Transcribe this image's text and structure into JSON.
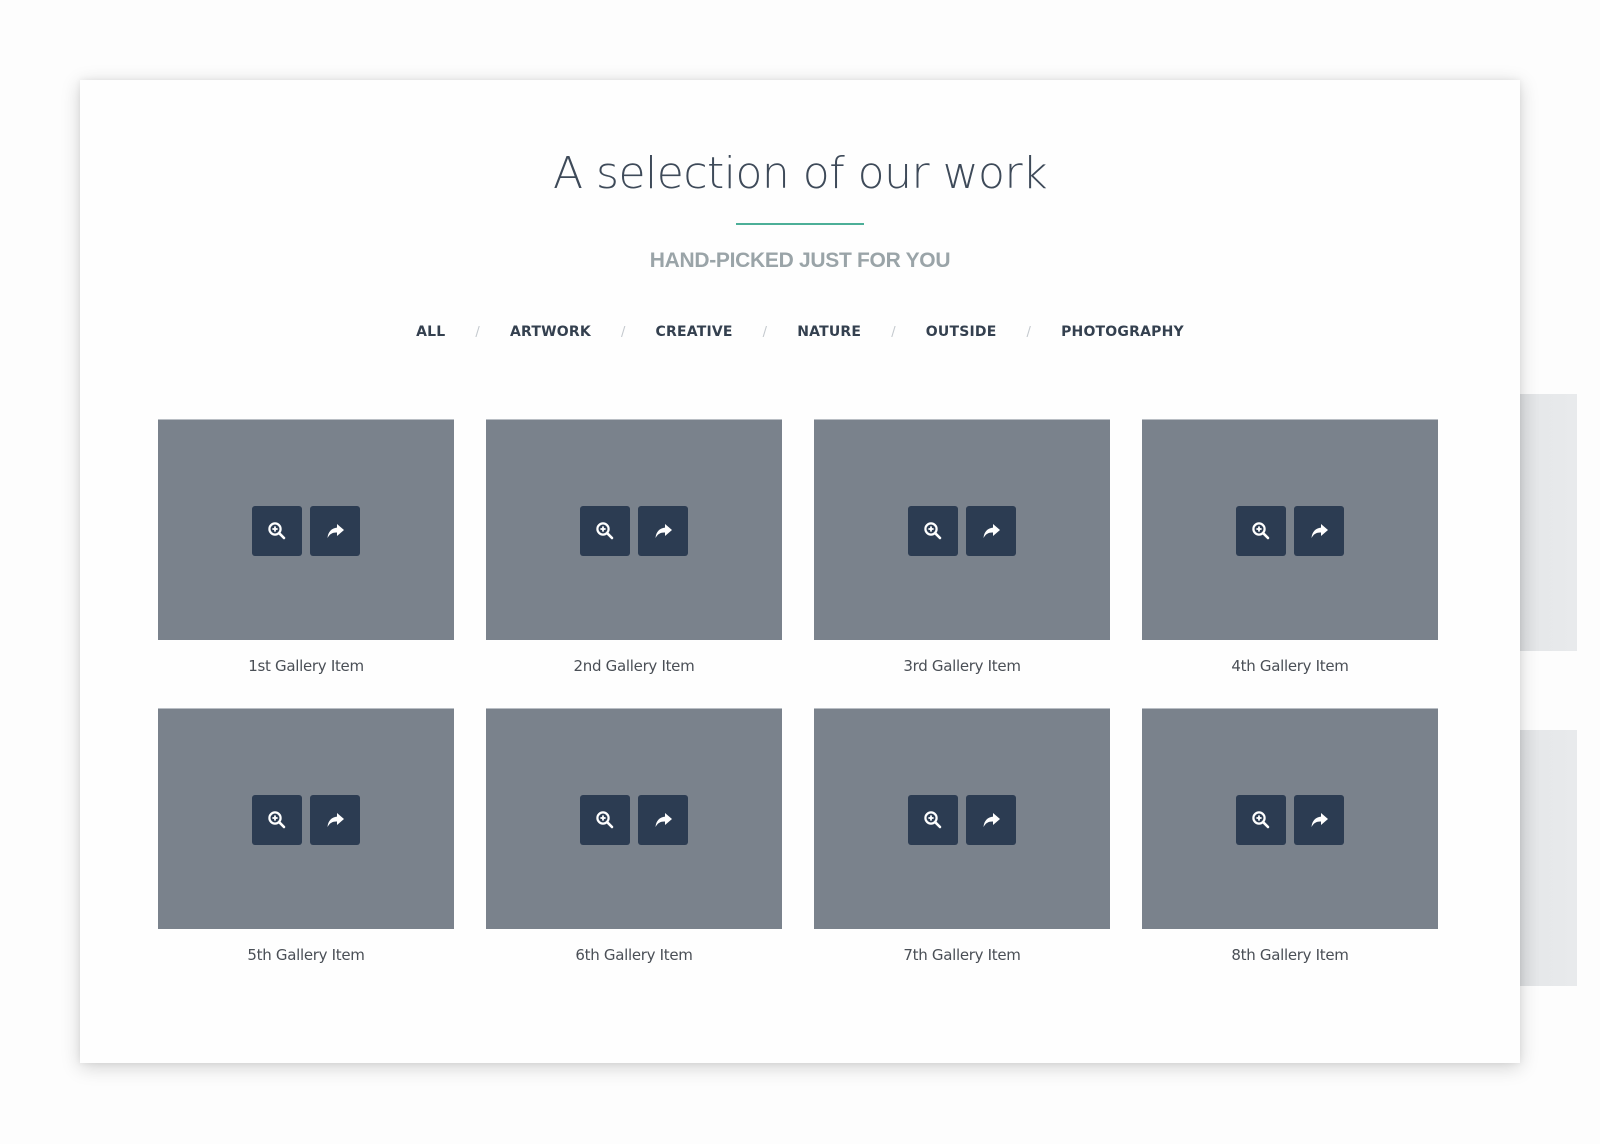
{
  "header": {
    "title": "A selection of our work",
    "subtitle": "HAND-PICKED JUST FOR YOU",
    "accent_color": "#4caf98"
  },
  "filters": {
    "separator": "/",
    "items": [
      {
        "label": "ALL"
      },
      {
        "label": "ARTWORK"
      },
      {
        "label": "CREATIVE"
      },
      {
        "label": "NATURE"
      },
      {
        "label": "OUTSIDE"
      },
      {
        "label": "PHOTOGRAPHY"
      }
    ]
  },
  "gallery": {
    "thumb_color": "#7a828c",
    "button_color": "#2c3c52",
    "actions": [
      {
        "icon": "zoom-in-icon"
      },
      {
        "icon": "share-icon"
      }
    ],
    "items": [
      {
        "caption": "1st Gallery Item"
      },
      {
        "caption": "2nd Gallery Item"
      },
      {
        "caption": "3rd Gallery Item"
      },
      {
        "caption": "4th Gallery Item"
      },
      {
        "caption": "5th Gallery Item"
      },
      {
        "caption": "6th Gallery Item"
      },
      {
        "caption": "7th Gallery Item"
      },
      {
        "caption": "8th Gallery Item"
      }
    ]
  }
}
